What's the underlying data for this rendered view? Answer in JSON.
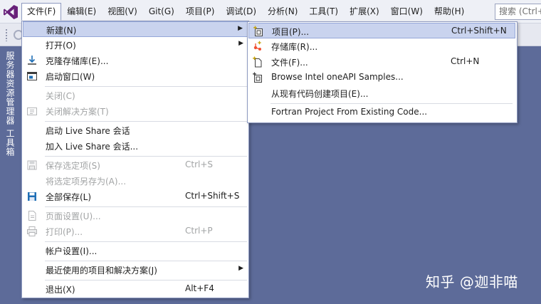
{
  "menubar": {
    "items": [
      {
        "label": "文件(F)"
      },
      {
        "label": "编辑(E)"
      },
      {
        "label": "视图(V)"
      },
      {
        "label": "Git(G)"
      },
      {
        "label": "项目(P)"
      },
      {
        "label": "调试(D)"
      },
      {
        "label": "分析(N)"
      },
      {
        "label": "工具(T)"
      },
      {
        "label": "扩展(X)"
      },
      {
        "label": "窗口(W)"
      },
      {
        "label": "帮助(H)"
      }
    ],
    "search_placeholder": "搜索 (Ctrl+Q)"
  },
  "side_tabs": [
    "服务器资源管理器",
    "工具箱"
  ],
  "file_menu": {
    "new": {
      "label": "新建(N)"
    },
    "open": {
      "label": "打开(O)"
    },
    "clone": {
      "label": "克隆存储库(E)..."
    },
    "start_window": {
      "label": "启动窗口(W)"
    },
    "close": {
      "label": "关闭(C)"
    },
    "close_solution": {
      "label": "关闭解决方案(T)"
    },
    "start_live_share": {
      "label": "启动 Live Share 会话"
    },
    "join_live_share": {
      "label": "加入 Live Share 会话..."
    },
    "save_selected": {
      "label": "保存选定项(S)",
      "shortcut": "Ctrl+S"
    },
    "save_selected_as": {
      "label": "将选定项另存为(A)..."
    },
    "save_all": {
      "label": "全部保存(L)",
      "shortcut": "Ctrl+Shift+S"
    },
    "page_setup": {
      "label": "页面设置(U)..."
    },
    "print": {
      "label": "打印(P)...",
      "shortcut": "Ctrl+P"
    },
    "account_settings": {
      "label": "帐户设置(I)..."
    },
    "recent": {
      "label": "最近使用的项目和解决方案(J)"
    },
    "exit": {
      "label": "退出(X)",
      "shortcut": "Alt+F4"
    }
  },
  "new_submenu": {
    "project": {
      "label": "项目(P)...",
      "shortcut": "Ctrl+Shift+N"
    },
    "repository": {
      "label": "存储库(R)..."
    },
    "file": {
      "label": "文件(F)...",
      "shortcut": "Ctrl+N"
    },
    "oneapi": {
      "label": "Browse Intel oneAPI Samples..."
    },
    "from_existing": {
      "label": "从现有代码创建项目(E)..."
    },
    "fortran": {
      "label": "Fortran Project From Existing Code..."
    }
  },
  "watermark": "知乎 @迦非喵",
  "colors": {
    "background": "#5d6b99",
    "highlight": "#c9d3ee",
    "vs_purple": "#68217a"
  }
}
